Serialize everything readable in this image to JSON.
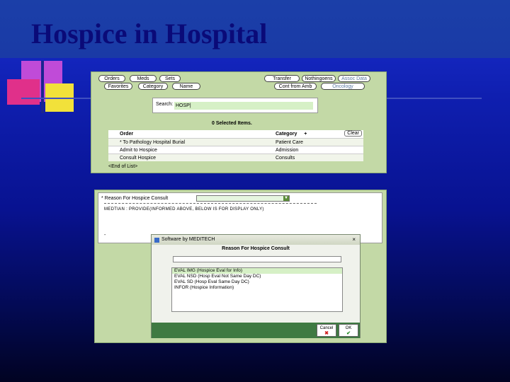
{
  "slide": {
    "title": "Hospice in Hospital"
  },
  "colors": {
    "panel_green": "#c3d9a6",
    "footer_green": "#3f7a42",
    "title_navy": "#0a0a78"
  },
  "order_panel": {
    "tabs_row1": [
      "Orders",
      "Meds",
      "Sets"
    ],
    "tabs_row1_right": [
      "Transfer",
      "Nothingoens",
      "Assoc Data"
    ],
    "tabs_row2": [
      "Favorites",
      "Category",
      "Name"
    ],
    "tabs_row2_right": [
      "Cont from Amb",
      "Oncology"
    ],
    "search_label": "Search:",
    "search_value": "HOSP|",
    "selected_count": "0 Selected Items.",
    "columns": {
      "order": "Order",
      "category": "Category",
      "add_icon": "+",
      "clear": "Clear"
    },
    "rows": [
      {
        "order": "* To Pathology Hospital Burial",
        "category": "Patient Care"
      },
      {
        "order": "Admit to Hospice",
        "category": "Admission"
      },
      {
        "order": "Consult Hospice",
        "category": "Consults"
      }
    ],
    "end_of_list": "<End of List>"
  },
  "consult_panel": {
    "reason_label": "* Reason For Hospice Consult",
    "caption": "MEDTIAN : PROVIDE(INFORMED ABOVE, BELOW IS FOR DISPLAY ONLY)",
    "dash_mark": "-"
  },
  "dialog": {
    "window_title": "Software by MEDITECH",
    "close_icon": "×",
    "heading": "Reason For Hospice Consult",
    "options": [
      "EVAL IMG (Hospice Eval for Info)",
      "EVAL NSD (Hosp Eval Not Same Day DC)",
      "EVAL SD (Hosp Eval Same Day DC)",
      "INFOR (Hospice Information)"
    ],
    "selected_index": 0,
    "cancel_label": "Cancel",
    "ok_label": "OK",
    "cancel_icon": "x-icon",
    "ok_icon": "check-icon"
  }
}
